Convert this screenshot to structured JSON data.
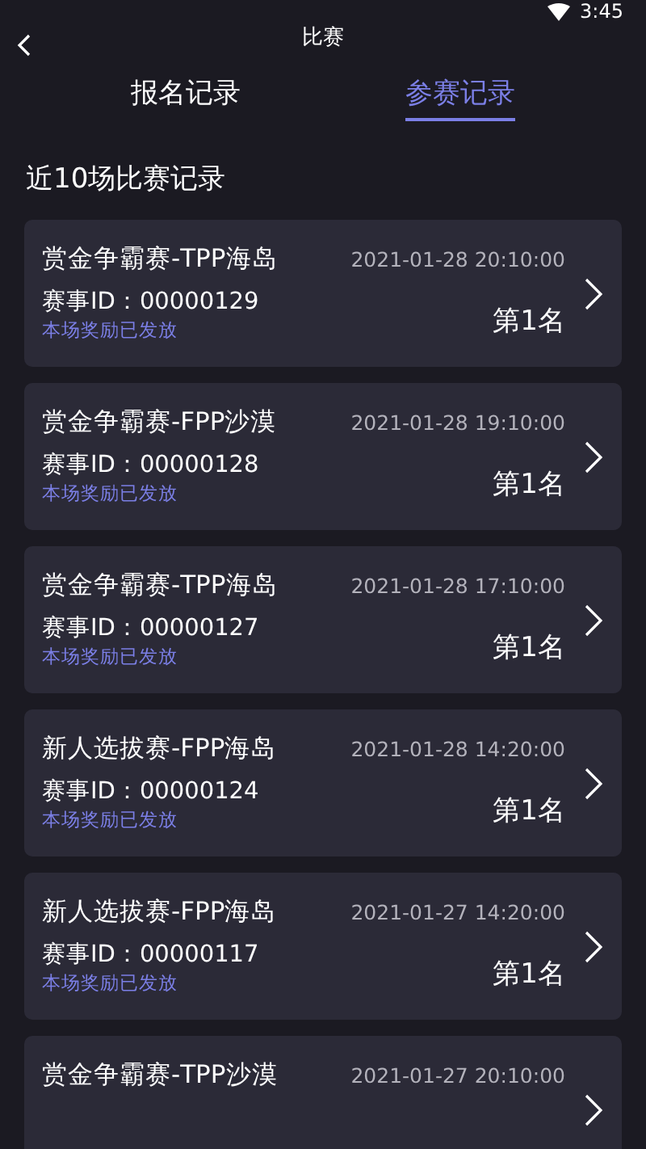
{
  "status_bar": {
    "time": "3:45"
  },
  "header": {
    "title": "比赛"
  },
  "tabs": [
    {
      "label": "报名记录",
      "selected": false
    },
    {
      "label": "参赛记录",
      "selected": true
    }
  ],
  "section_title": "近10场比赛记录",
  "records": [
    {
      "title": "赏金争霸赛-TPP海岛",
      "time": "2021-01-28 20:10:00",
      "match_id": "赛事ID：00000129",
      "reward": "本场奖励已发放",
      "rank": "第1名"
    },
    {
      "title": "赏金争霸赛-FPP沙漠",
      "time": "2021-01-28 19:10:00",
      "match_id": "赛事ID：00000128",
      "reward": "本场奖励已发放",
      "rank": "第1名"
    },
    {
      "title": "赏金争霸赛-TPP海岛",
      "time": "2021-01-28 17:10:00",
      "match_id": "赛事ID：00000127",
      "reward": "本场奖励已发放",
      "rank": "第1名"
    },
    {
      "title": "新人选拔赛-FPP海岛",
      "time": "2021-01-28 14:20:00",
      "match_id": "赛事ID：00000124",
      "reward": "本场奖励已发放",
      "rank": "第1名"
    },
    {
      "title": "新人选拔赛-FPP海岛",
      "time": "2021-01-27 14:20:00",
      "match_id": "赛事ID：00000117",
      "reward": "本场奖励已发放",
      "rank": "第1名"
    },
    {
      "title": "赏金争霸赛-TPP沙漠",
      "time": "2021-01-27 20:10:00"
    }
  ]
}
